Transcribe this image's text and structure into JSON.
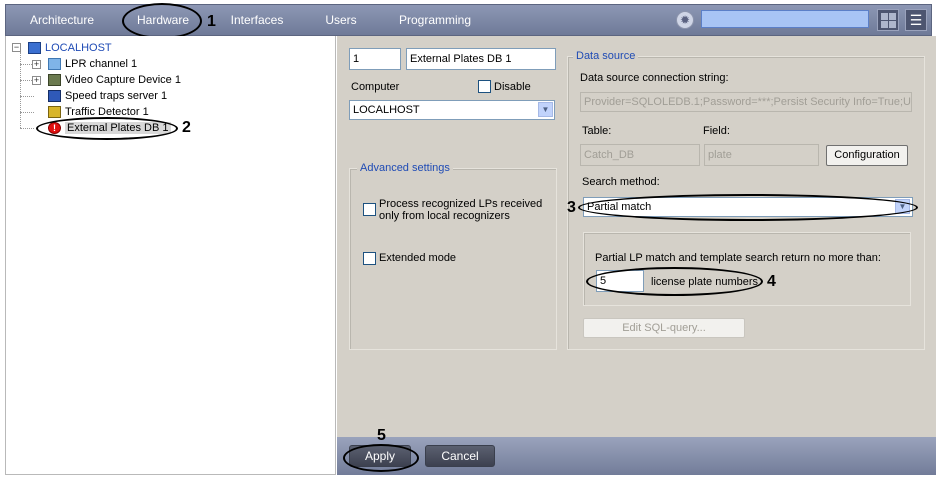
{
  "tabs": [
    {
      "label": "Architecture"
    },
    {
      "label": "Hardware"
    },
    {
      "label": "Interfaces"
    },
    {
      "label": "Users"
    },
    {
      "label": "Programming"
    }
  ],
  "annotations": {
    "n1": "1",
    "n2": "2",
    "n3": "3",
    "n4": "4",
    "n5": "5"
  },
  "tree": {
    "root": "LOCALHOST",
    "items": [
      {
        "label": "LPR channel 1"
      },
      {
        "label": "Video Capture Device 1"
      },
      {
        "label": "Speed traps server 1"
      },
      {
        "label": "Traffic Detector 1"
      },
      {
        "label": "External Plates DB 1"
      }
    ]
  },
  "settings": {
    "id": "1",
    "name": "External Plates DB 1",
    "computer_label": "Computer",
    "disable_label": "Disable",
    "computer_value": "LOCALHOST",
    "advanced_title": "Advanced settings",
    "process_local_label": "Process recognized LPs received only from local recognizers",
    "extended_mode_label": "Extended mode"
  },
  "datasource": {
    "title": "Data source",
    "conn_label": "Data source connection string:",
    "conn_value": "Provider=SQLOLEDB.1;Password=***;Persist Security Info=True;Use",
    "table_label": "Table:",
    "field_label": "Field:",
    "table_value": "Catch_DB",
    "field_value": "plate",
    "config_button": "Configuration",
    "search_method_label": "Search method:",
    "search_method_value": "Partial match",
    "limit_text": "Partial LP match and template search return no more than:",
    "limit_value": "5",
    "limit_suffix": "license plate numbers",
    "edit_sql_button": "Edit SQL-query..."
  },
  "footer": {
    "apply": "Apply",
    "cancel": "Cancel"
  },
  "colors": {
    "tab_bar": "#7d87a6",
    "panel_bg": "#d4d0c8",
    "link_blue": "#1f4bb5",
    "search_field": "#a8c4f5"
  }
}
